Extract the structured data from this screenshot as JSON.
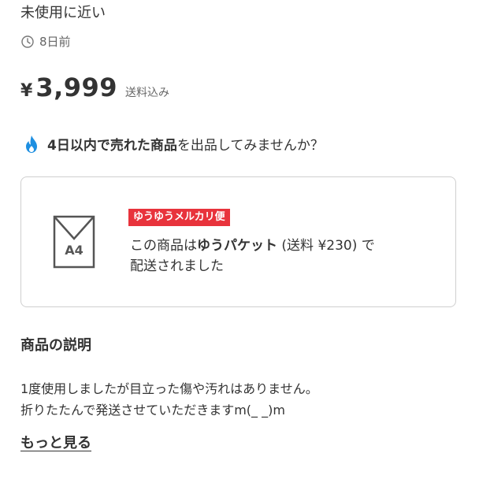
{
  "item": {
    "condition": "未使用に近い",
    "posted_ago": "8日前",
    "price_currency": "¥",
    "price_value": "3,999",
    "price_note": "送料込み"
  },
  "promo": {
    "bold": "4日以内で売れた商品",
    "rest": "を出品してみませんか？"
  },
  "shipping": {
    "envelope_label": "A4",
    "carrier_badge": "ゆうゆうメルカリ便",
    "text_prefix": "この商品は",
    "method": "ゆうパケット",
    "text_suffix": " (送料 ¥230) で",
    "text_line2": "配送されました"
  },
  "description": {
    "title": "商品の説明",
    "line1": "1度使用しましたが目立った傷や汚れはありません。",
    "line2": "折りたたんで発送させていただきますm(_ _)m",
    "more_label": "もっと見る"
  },
  "icons": {
    "clock": "clock-icon",
    "fire": "fire-icon",
    "envelope": "envelope-icon"
  },
  "colors": {
    "badge_red": "#e8333c",
    "fire_blue": "#1e8fe1",
    "text": "#333333"
  }
}
